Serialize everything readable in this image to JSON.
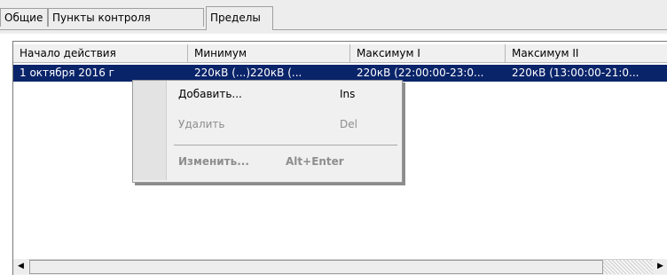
{
  "tabs": [
    {
      "label": "Общие"
    },
    {
      "label": "Пункты контроля"
    },
    {
      "label": "Пределы"
    }
  ],
  "table": {
    "columns": [
      "Начало действия",
      "Минимум",
      "Максимум I",
      "Максимум II"
    ],
    "rows": [
      [
        "1 октября 2016 г",
        "220кВ (...)220кВ (...",
        "220кВ (22:00:00-23:0...",
        "220кВ (13:00:00-21:0..."
      ]
    ]
  },
  "context_menu": {
    "items": [
      {
        "label": "Добавить...",
        "shortcut": "Ins",
        "enabled": true,
        "bold": false
      },
      {
        "label": "Удалить",
        "shortcut": "Del",
        "enabled": false,
        "bold": false
      },
      {
        "label": "Изменить...",
        "shortcut": "Alt+Enter",
        "enabled": false,
        "bold": true
      }
    ]
  },
  "scrollbar": {
    "left_arrow": "◀",
    "right_arrow": "▶"
  }
}
